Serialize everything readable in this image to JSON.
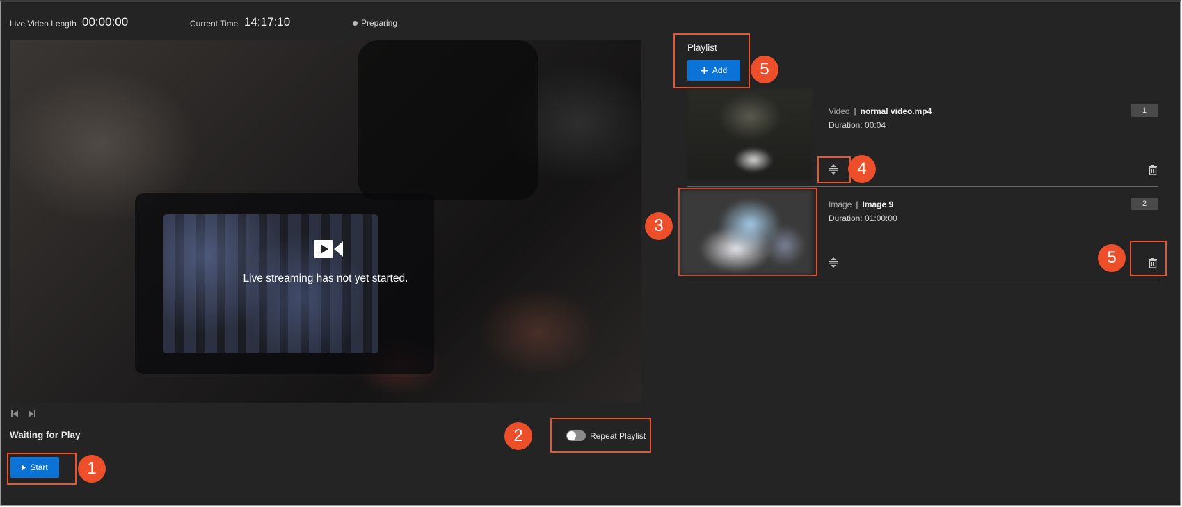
{
  "topbar": {
    "live_length_label": "Live Video Length",
    "live_length_value": "00:00:00",
    "current_time_label": "Current Time",
    "current_time_value": "14:17:10",
    "status": "Preparing"
  },
  "player": {
    "message": "Live streaming has not yet started.",
    "state": "Waiting for Play",
    "start_label": "Start",
    "repeat_label": "Repeat Playlist",
    "repeat_enabled": false
  },
  "playlist": {
    "title": "Playlist",
    "add_label": "Add",
    "items": [
      {
        "kind": "Video",
        "separator": "|",
        "name": "normal video.mp4",
        "duration": "Duration: 00:04",
        "index": "1"
      },
      {
        "kind": "Image",
        "separator": "|",
        "name": "Image 9",
        "duration": "Duration: 01:00:00",
        "index": "2"
      }
    ]
  },
  "callouts": [
    "1",
    "2",
    "3",
    "4",
    "5",
    "5"
  ],
  "colors": {
    "accent": "#0b72d6",
    "callout": "#ec4f2a",
    "background": "#242424"
  }
}
